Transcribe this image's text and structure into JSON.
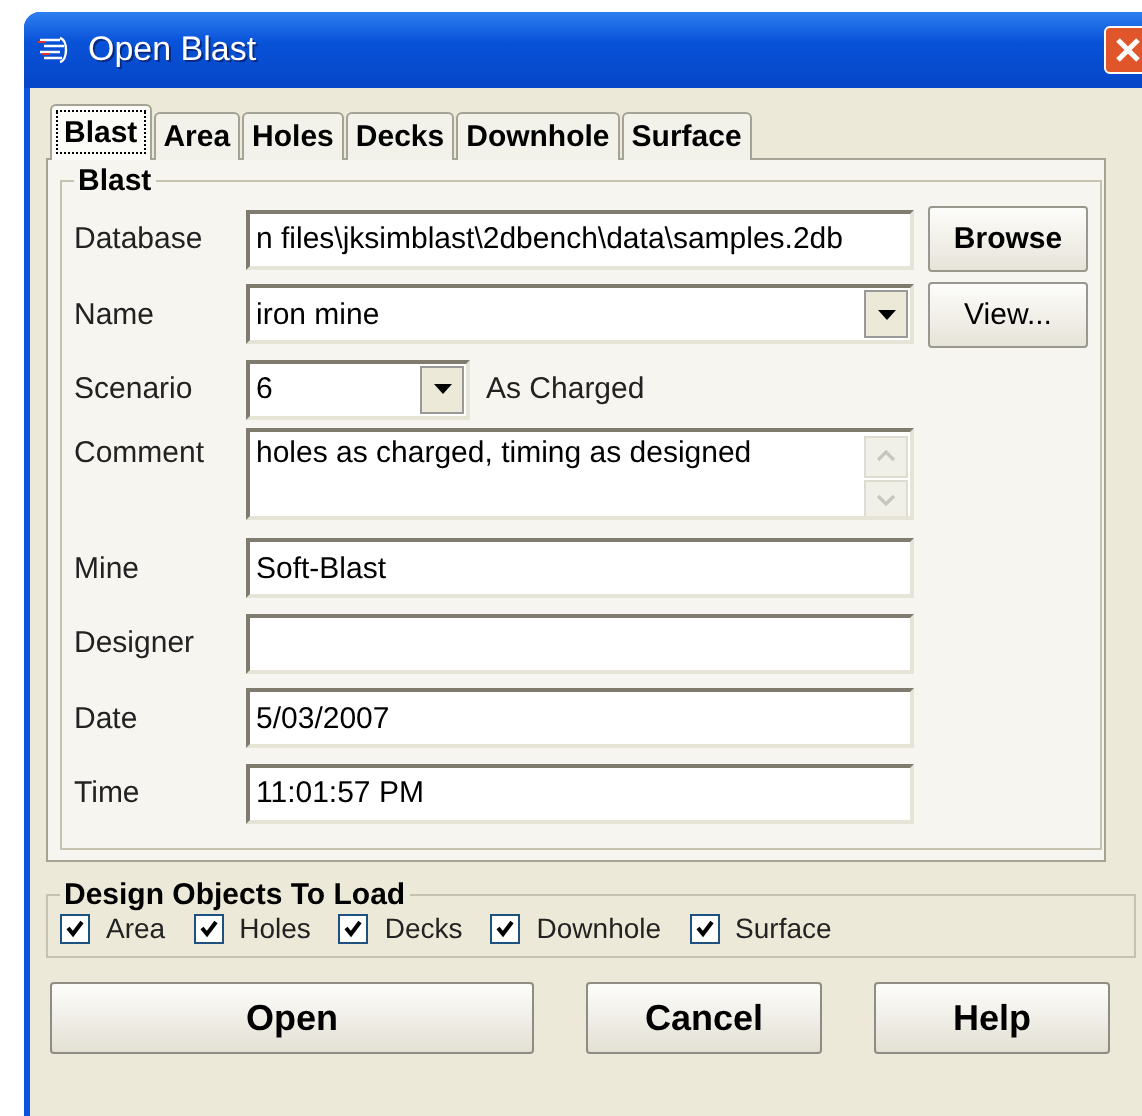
{
  "window": {
    "title": "Open Blast"
  },
  "tabs": [
    {
      "label": "Blast",
      "selected": true
    },
    {
      "label": "Area",
      "selected": false
    },
    {
      "label": "Holes",
      "selected": false
    },
    {
      "label": "Decks",
      "selected": false
    },
    {
      "label": "Downhole",
      "selected": false
    },
    {
      "label": "Surface",
      "selected": false
    }
  ],
  "blast_group": {
    "title": "Blast",
    "fields": [
      {
        "label": "Database",
        "kind": "text",
        "value": "n files\\jksimblast\\2dbench\\data\\samples.2db",
        "button": "Browse"
      },
      {
        "label": "Name",
        "kind": "combo",
        "value": "iron mine",
        "button": "View..."
      },
      {
        "label": "Scenario",
        "kind": "small-combo",
        "value": "6",
        "note": "As Charged"
      },
      {
        "label": "Comment",
        "kind": "memo",
        "value": "holes as charged, timing as designed"
      },
      {
        "label": "Mine",
        "kind": "text",
        "value": "Soft-Blast"
      },
      {
        "label": "Designer",
        "kind": "text"
      },
      {
        "label": "Date",
        "kind": "text",
        "value": "5/03/2007"
      },
      {
        "label": "Time",
        "kind": "text",
        "value": "11:01:57 PM"
      }
    ]
  },
  "load_group": {
    "title": "Design Objects To Load",
    "options": [
      {
        "label": "Area",
        "checked": true
      },
      {
        "label": "Holes",
        "checked": true
      },
      {
        "label": "Decks",
        "checked": true
      },
      {
        "label": "Downhole",
        "checked": true
      },
      {
        "label": "Surface",
        "checked": true
      }
    ]
  },
  "buttons": [
    "Open",
    "Cancel",
    "Help"
  ]
}
